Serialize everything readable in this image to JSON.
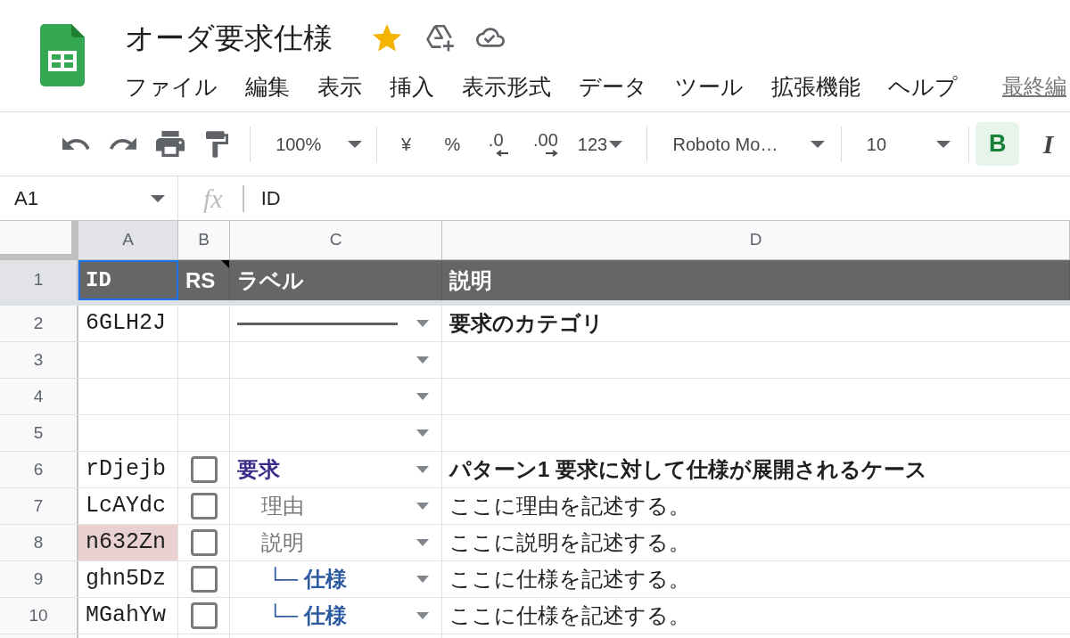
{
  "app": {
    "title": "オーダ要求仕様",
    "starred": true
  },
  "menu": [
    "ファイル",
    "編集",
    "表示",
    "挿入",
    "表示形式",
    "データ",
    "ツール",
    "拡張機能",
    "ヘルプ"
  ],
  "last_edit": "最終編",
  "toolbar": {
    "zoom": "100%",
    "currency": "¥",
    "percent": "%",
    "decrease_decimals": ".0",
    "increase_decimals": ".00",
    "number_format": "123",
    "font": "Roboto Mo…",
    "font_size": "10",
    "format_buttons": [
      {
        "kind": "bold",
        "label": "B",
        "selected": true
      },
      {
        "kind": "italic",
        "label": "I",
        "selected": false
      }
    ]
  },
  "formula_bar": {
    "cell": "A1",
    "fx": "fx",
    "value": "ID"
  },
  "sheet": {
    "columns": [
      {
        "label": "A",
        "selected": true
      },
      {
        "label": "B",
        "selected": false
      },
      {
        "label": "C",
        "selected": false
      },
      {
        "label": "D",
        "selected": false
      }
    ],
    "header_row": {
      "number": "1",
      "selected": true,
      "cells": [
        {
          "text": "ID",
          "selected": true,
          "note": false
        },
        {
          "text": "RS",
          "selected": false,
          "note": true
        },
        {
          "text": "ラベル",
          "selected": false,
          "note": false
        },
        {
          "text": "説明",
          "selected": false,
          "note": false
        }
      ]
    },
    "rows": [
      {
        "number": "2",
        "selected": false,
        "id": "6GLH2J",
        "highlighted": false,
        "label": {
          "kind": "rule"
        },
        "description": "要求のカテゴリ",
        "bold": true
      },
      {
        "number": "3",
        "selected": false,
        "highlighted": false,
        "label": {
          "kind": "empty"
        }
      },
      {
        "number": "4",
        "selected": false,
        "highlighted": false,
        "label": {
          "kind": "empty"
        }
      },
      {
        "number": "5",
        "selected": false,
        "highlighted": false,
        "label": {
          "kind": "empty"
        }
      },
      {
        "number": "6",
        "selected": false,
        "id": "rDjejb",
        "highlighted": false,
        "rs": {
          "checked": false
        },
        "label": {
          "kind": "category",
          "text": "要求"
        },
        "description": "パターン1 要求に対して仕様が展開されるケース",
        "bold": true
      },
      {
        "number": "7",
        "selected": false,
        "id": "LcAYdc",
        "highlighted": false,
        "rs": {
          "checked": false
        },
        "label": {
          "kind": "detail",
          "text": "理由"
        },
        "description": "ここに理由を記述する。",
        "bold": false
      },
      {
        "number": "8",
        "selected": false,
        "id": "n632Zn",
        "highlighted": true,
        "rs": {
          "checked": false
        },
        "label": {
          "kind": "detail",
          "text": "説明"
        },
        "description": "ここに説明を記述する。",
        "bold": false
      },
      {
        "number": "9",
        "selected": false,
        "id": "ghn5Dz",
        "highlighted": false,
        "rs": {
          "checked": false
        },
        "label": {
          "kind": "spec",
          "text": "└─ 仕様"
        },
        "description": "ここに仕様を記述する。",
        "bold": false
      },
      {
        "number": "10",
        "selected": false,
        "id": "MGahYw",
        "highlighted": false,
        "rs": {
          "checked": false
        },
        "label": {
          "kind": "spec",
          "text": "└─ 仕様"
        },
        "description": "ここに仕様を記述する。",
        "bold": false
      }
    ]
  }
}
